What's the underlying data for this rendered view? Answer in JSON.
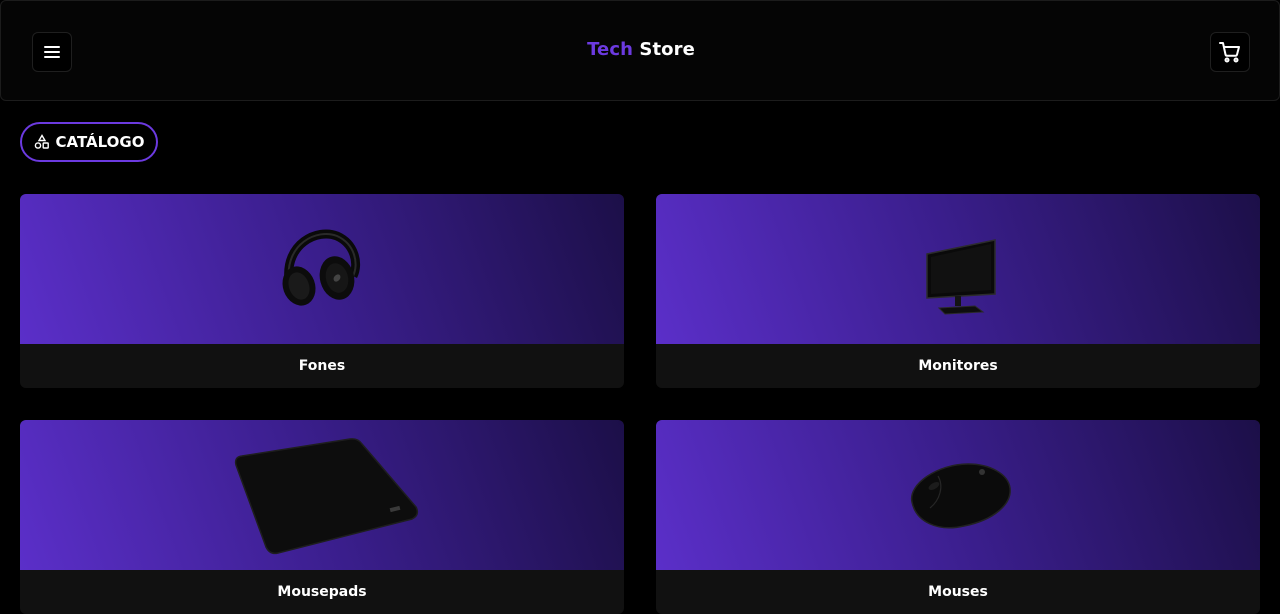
{
  "header": {
    "brand_accent": "Tech",
    "brand_rest": " Store",
    "menu_icon": "hamburger-menu-icon",
    "cart_icon": "shopping-cart-icon"
  },
  "catalog": {
    "label": "CATÁLOGO",
    "icon": "shapes-icon"
  },
  "categories": [
    {
      "label": "Fones",
      "image": "headphones-image"
    },
    {
      "label": "Monitores",
      "image": "monitor-image"
    },
    {
      "label": "Mousepads",
      "image": "mousepad-image"
    },
    {
      "label": "Mouses",
      "image": "mouse-image"
    }
  ],
  "colors": {
    "accent": "#6c3ae0",
    "background": "#000000",
    "card_footer": "#111111"
  }
}
